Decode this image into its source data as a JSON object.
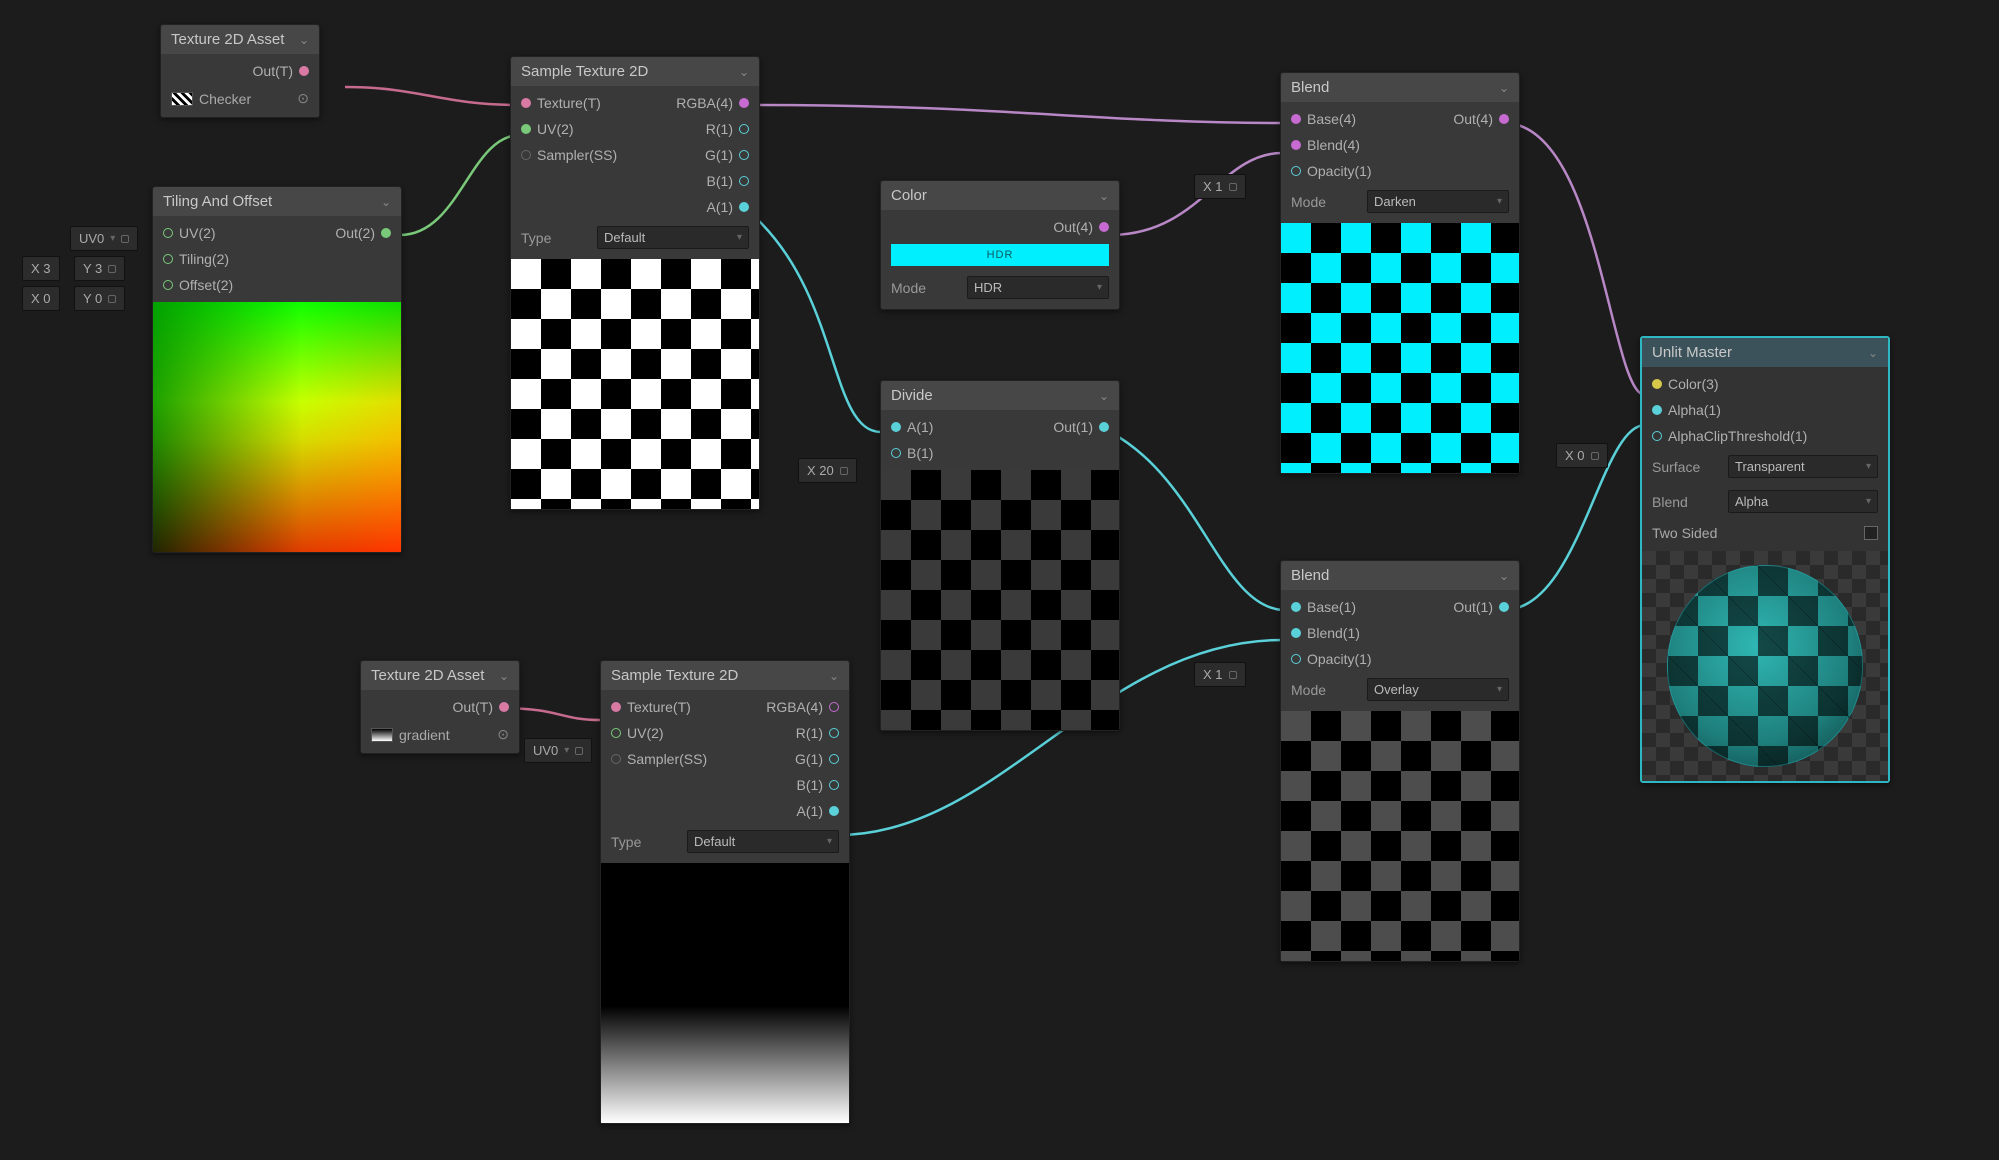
{
  "nodes": {
    "tex2dAsset1": {
      "title": "Texture 2D Asset",
      "out": "Out(T)",
      "asset": "Checker"
    },
    "tex2dAsset2": {
      "title": "Texture 2D Asset",
      "out": "Out(T)",
      "asset": "gradient"
    },
    "tilingOffset": {
      "title": "Tiling And Offset",
      "uv": "UV(2)",
      "tiling": "Tiling(2)",
      "offset": "Offset(2)",
      "out": "Out(2)"
    },
    "sample1": {
      "title": "Sample Texture 2D",
      "tex": "Texture(T)",
      "uv": "UV(2)",
      "samp": "Sampler(SS)",
      "rgba": "RGBA(4)",
      "r": "R(1)",
      "g": "G(1)",
      "b": "B(1)",
      "a": "A(1)",
      "typeLabel": "Type",
      "type": "Default"
    },
    "sample2": {
      "title": "Sample Texture 2D",
      "tex": "Texture(T)",
      "uv": "UV(2)",
      "samp": "Sampler(SS)",
      "rgba": "RGBA(4)",
      "r": "R(1)",
      "g": "G(1)",
      "b": "B(1)",
      "a": "A(1)",
      "typeLabel": "Type",
      "type": "Default"
    },
    "color": {
      "title": "Color",
      "out": "Out(4)",
      "modeLabel": "Mode",
      "mode": "HDR"
    },
    "divide": {
      "title": "Divide",
      "a": "A(1)",
      "b": "B(1)",
      "out": "Out(1)"
    },
    "blend1": {
      "title": "Blend",
      "base": "Base(4)",
      "blend": "Blend(4)",
      "opacity": "Opacity(1)",
      "out": "Out(4)",
      "modeLabel": "Mode",
      "mode": "Darken"
    },
    "blend2": {
      "title": "Blend",
      "base": "Base(1)",
      "blend": "Blend(1)",
      "opacity": "Opacity(1)",
      "out": "Out(1)",
      "modeLabel": "Mode",
      "mode": "Overlay"
    },
    "master": {
      "title": "Unlit Master",
      "color": "Color(3)",
      "alpha": "Alpha(1)",
      "clip": "AlphaClipThreshold(1)",
      "surfaceLabel": "Surface",
      "surface": "Transparent",
      "blendLabel": "Blend",
      "blend": "Alpha",
      "twoSided": "Two Sided"
    }
  },
  "chips": {
    "uv0a": "UV0",
    "uv0b": "UV0",
    "x3": "X 3",
    "y3": "Y 3",
    "x0a": "X 0",
    "y0": "Y 0",
    "x20": "X 20",
    "x1a": "X 1",
    "x1b": "X 1",
    "x0b": "X 0"
  }
}
